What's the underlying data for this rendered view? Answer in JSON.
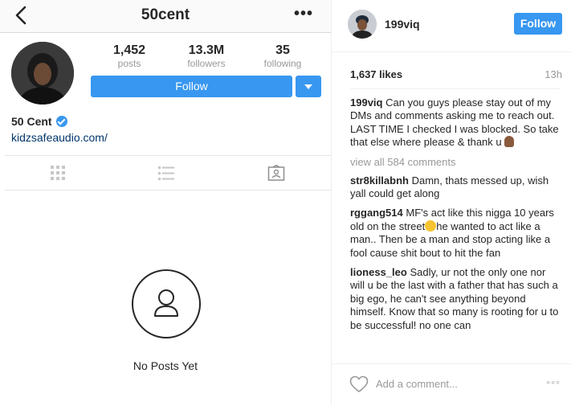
{
  "profile": {
    "title": "50cent",
    "stats": [
      {
        "value": "1,452",
        "label": "posts"
      },
      {
        "value": "13.3M",
        "label": "followers"
      },
      {
        "value": "35",
        "label": "following"
      }
    ],
    "follow_label": "Follow",
    "name": "50 Cent",
    "link": "kidzsafeaudio.com/",
    "empty_state": "No Posts Yet"
  },
  "post": {
    "username": "199viq",
    "follow_label": "Follow",
    "likes": "1,637 likes",
    "time": "13h",
    "caption_user": "199viq",
    "caption": "Can you guys please stay out of my DMs and comments asking me to reach out. LAST TIME I checked I was blocked. So take that else where please & thank u",
    "view_all": "view all 584 comments",
    "comments": [
      {
        "user": "str8killabnh",
        "text": "Damn, thats messed up, wish yall could get along"
      },
      {
        "user": "rggang514",
        "text_before": "MF's act like this nigga 10 years old on the street",
        "text_after": "he wanted to act like a man.. Then be a man and stop acting like a fool cause shit bout to hit the fan"
      },
      {
        "user": "lioness_leo",
        "text": "Sadly, ur not the only one nor will u be the last with a father that has such a big ego, he can't see anything beyond himself. Know that so many is rooting for u to be successful! no one can"
      }
    ],
    "add_comment_placeholder": "Add a comment..."
  },
  "colors": {
    "accent": "#3897f0",
    "muted": "#999999",
    "link": "#003569"
  },
  "icons": [
    "back-chevron-icon",
    "more-options-icon",
    "verified-badge-icon",
    "grid-view-icon",
    "list-view-icon",
    "tagged-icon",
    "person-icon",
    "heart-icon",
    "more-dots-icon",
    "praying-hands-emoji",
    "laughing-emoji"
  ]
}
